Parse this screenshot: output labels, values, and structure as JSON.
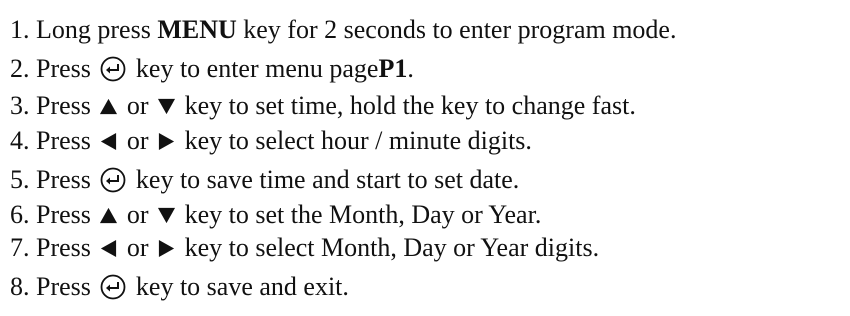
{
  "steps": [
    {
      "num": "1.",
      "t1": "Long press",
      "bold1": "MENU",
      "t2": "key for 2 seconds to enter program mode."
    },
    {
      "num": "2.",
      "t1": "Press",
      "t2": "key to enter menu page",
      "bold1": "P1",
      "t3": "."
    },
    {
      "num": "3.",
      "t1": "Press",
      "or": "or",
      "t2": "key to set time, hold the key to change fast."
    },
    {
      "num": "4.",
      "t1": "Press",
      "or": "or",
      "t2": "key to select hour / minute digits."
    },
    {
      "num": "5.",
      "t1": "Press",
      "t2": "key to save time and start to set date."
    },
    {
      "num": "6.",
      "t1": "Press",
      "or": "or",
      "t2": "key to set the Month, Day or Year."
    },
    {
      "num": "7.",
      "t1": "Press",
      "or": "or",
      "t2": "key to select Month, Day or Year digits."
    },
    {
      "num": "8.",
      "t1": "Press",
      "t2": "key to save and exit."
    }
  ],
  "icons": {
    "enter": "enter-key-icon",
    "up": "up-arrow-icon",
    "down": "down-arrow-icon",
    "left": "left-arrow-icon",
    "right": "right-arrow-icon"
  }
}
